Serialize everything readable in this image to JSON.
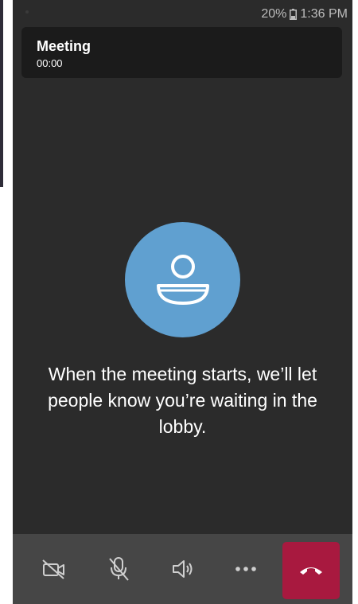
{
  "status_bar": {
    "battery_percent": "20%",
    "time": "1:36 PM"
  },
  "meeting": {
    "title": "Meeting",
    "timer": "00:00"
  },
  "lobby": {
    "message": "When the meeting starts, we’ll let people know you’re waiting in the lobby."
  },
  "controls": [
    {
      "name": "camera-off-button",
      "icon": "video-off-icon"
    },
    {
      "name": "mute-button",
      "icon": "mic-off-icon"
    },
    {
      "name": "speaker-button",
      "icon": "speaker-icon"
    },
    {
      "name": "more-options-button",
      "icon": "more-horizontal-icon"
    },
    {
      "name": "hang-up-button",
      "icon": "phone-hangup-icon"
    }
  ],
  "colors": {
    "background": "#2b2b2b",
    "header_bg": "#1b1b1b",
    "avatar_bg": "#60a0d0",
    "call_bar_bg": "#464646",
    "hangup_bg": "#a8193f"
  }
}
